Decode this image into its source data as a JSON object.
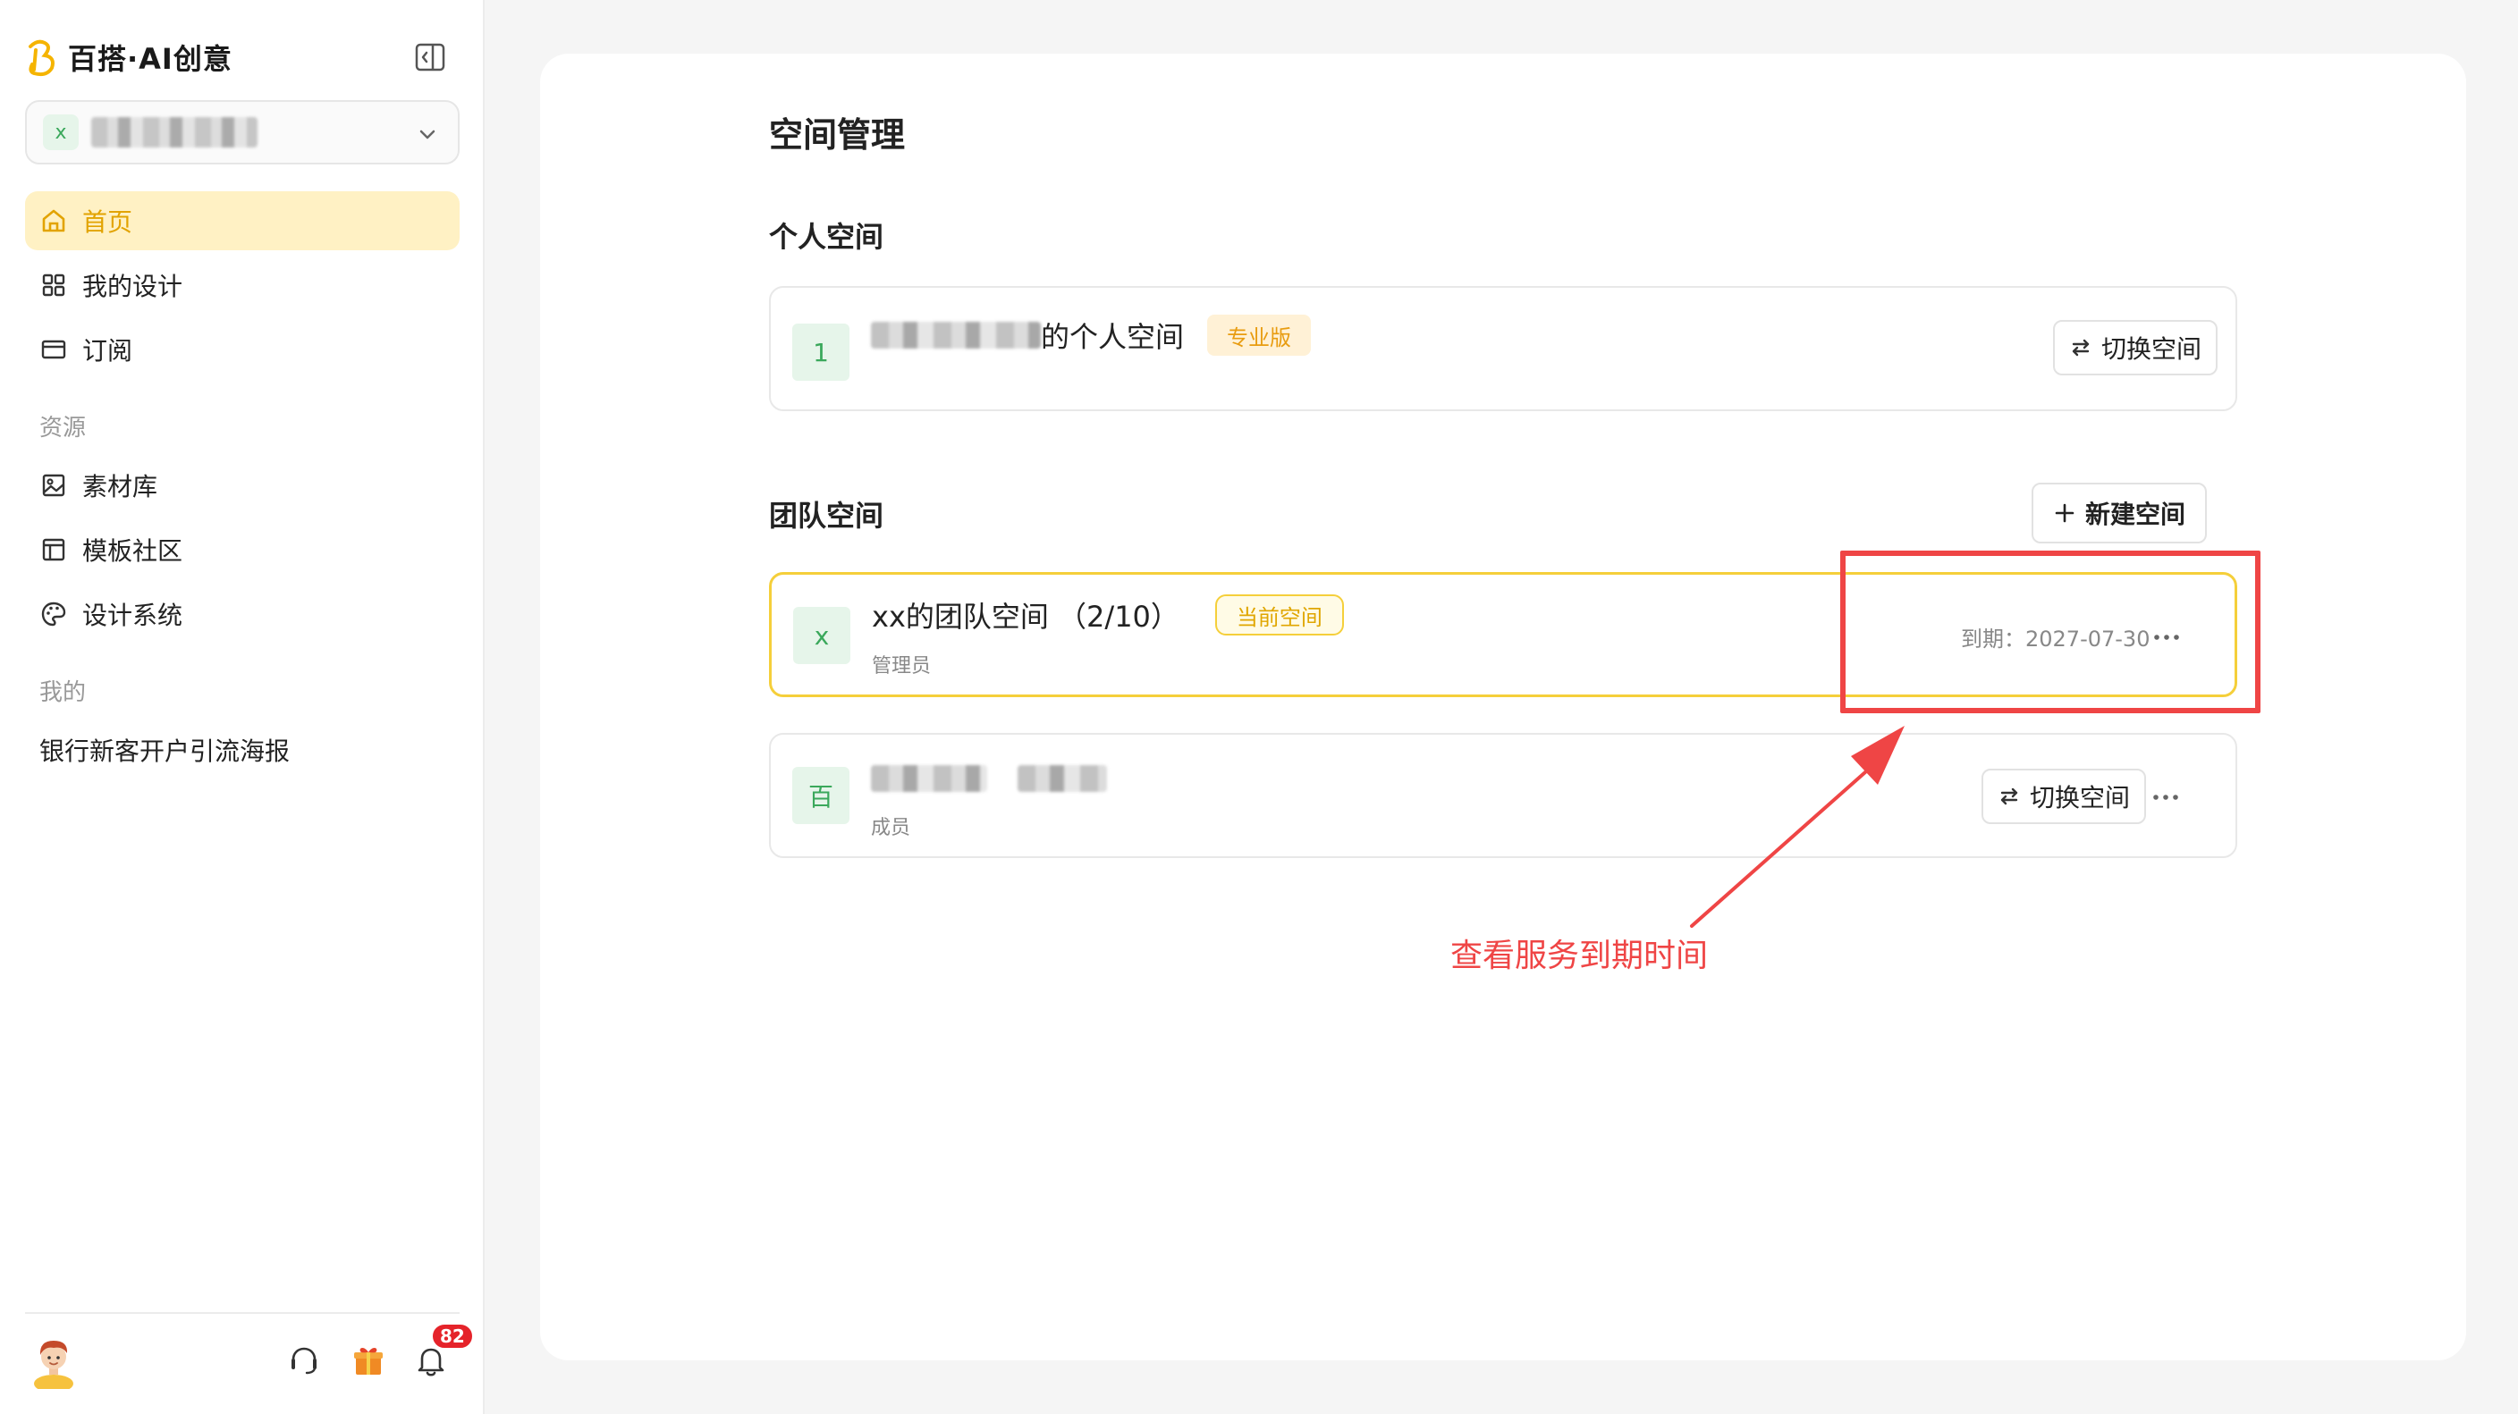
{
  "brand": {
    "title": "百搭·AI创意"
  },
  "workspace_selector": {
    "avatar_letter": "x"
  },
  "nav": {
    "items": [
      {
        "label": "首页",
        "icon": "home-icon",
        "active": true
      },
      {
        "label": "我的设计",
        "icon": "grid-icon",
        "active": false
      },
      {
        "label": "订阅",
        "icon": "card-icon",
        "active": false
      }
    ],
    "resources_heading": "资源",
    "resources": [
      {
        "label": "素材库",
        "icon": "image-icon"
      },
      {
        "label": "模板社区",
        "icon": "template-icon"
      },
      {
        "label": "设计系统",
        "icon": "palette-icon"
      }
    ],
    "mine_heading": "我的",
    "mine": [
      {
        "label": "银行新客开户引流海报"
      }
    ]
  },
  "footer": {
    "notification_count": "82"
  },
  "main": {
    "page_title": "空间管理",
    "personal": {
      "heading": "个人空间",
      "card": {
        "avatar_letter": "1",
        "name_suffix": "的个人空间",
        "tag": "专业版",
        "switch_label": "切换空间"
      }
    },
    "team": {
      "heading": "团队空间",
      "new_button_label": "新建空间",
      "cards": [
        {
          "avatar_letter": "x",
          "name": "xx的团队空间 （2/10）",
          "tag": "当前空间",
          "role": "管理员",
          "expiry": "到期：2027-07-30"
        },
        {
          "avatar_letter": "百",
          "role": "成员",
          "switch_label": "切换空间"
        }
      ]
    }
  },
  "annotation": {
    "text": "查看服务到期时间",
    "color": "#ef4545"
  },
  "colors": {
    "accent": "#f5cf3a",
    "active_text": "#e2a300",
    "avatar_bg": "#e6f5ea",
    "avatar_text": "#3aa85b"
  }
}
